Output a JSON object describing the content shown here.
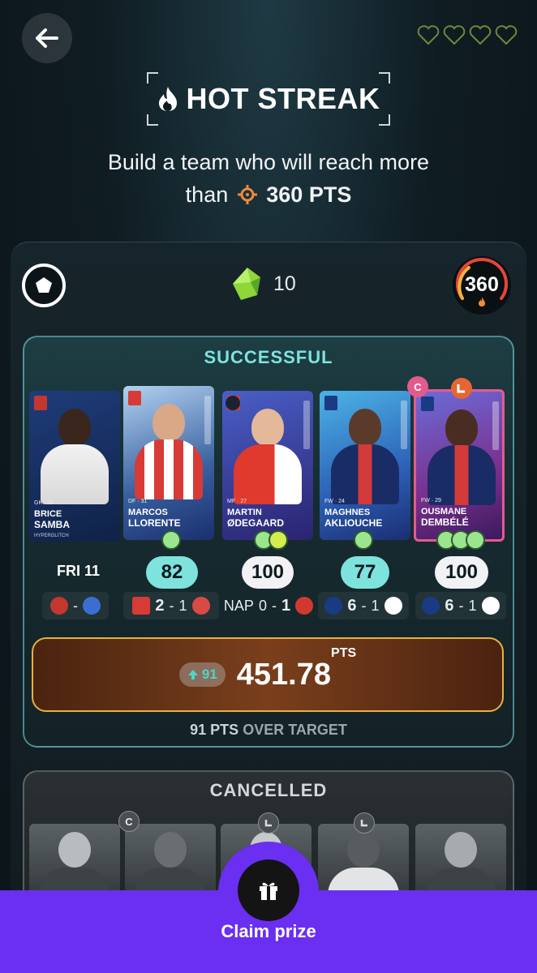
{
  "header": {
    "title": "HOT STREAK",
    "subtitle_line1": "Build a team who will reach more",
    "subtitle_prefix": "than",
    "target_pts": "360 PTS",
    "lives": 4
  },
  "panel": {
    "gems": "10",
    "goal": "360"
  },
  "successful": {
    "label": "SUCCESSFUL",
    "players": [
      {
        "first": "BRICE",
        "last": "SAMBA",
        "pos": "GK",
        "num": "32",
        "tag": "HYPERGLITCH",
        "score": "",
        "fixture_label": "FRI 11",
        "match_home": "",
        "match_score_home": "",
        "match_score_away": "",
        "match_dash": "-"
      },
      {
        "first": "MARCOS",
        "last": "LLORENTE",
        "pos": "DF",
        "num": "31",
        "tag": "",
        "score": "82",
        "match_home": "",
        "match_score_home": "2",
        "match_score_away": "1",
        "match_dash": "-"
      },
      {
        "first": "MARTIN",
        "last": "ØDEGAARD",
        "pos": "MF",
        "num": "27",
        "tag": "",
        "score": "100",
        "match_home": "NAP",
        "match_score_home": "0",
        "match_score_away": "1",
        "match_dash": "-"
      },
      {
        "first": "MAGHNES",
        "last": "AKLIOUCHE",
        "pos": "FW",
        "num": "24",
        "tag": "",
        "score": "77",
        "match_home": "",
        "match_score_home": "6",
        "match_score_away": "1",
        "match_dash": "-"
      },
      {
        "first": "OUSMANE",
        "last": "DEMBÉLÉ",
        "pos": "FW",
        "num": "29",
        "tag": "",
        "score": "100",
        "match_home": "",
        "match_score_home": "6",
        "match_score_away": "1",
        "match_dash": "-",
        "captain": "C"
      }
    ],
    "boost": "91",
    "total": "451.78",
    "total_unit": "PTS",
    "over_value": "91 PTS",
    "over_text": "OVER TARGET"
  },
  "cancelled": {
    "label": "CANCELLED",
    "captain": "C"
  },
  "footer": {
    "claim_label": "Claim prize"
  },
  "colors": {
    "accent_teal": "#7fe3dd",
    "claim_purple": "#6a2ff0",
    "gold_border": "#e9b13c"
  }
}
